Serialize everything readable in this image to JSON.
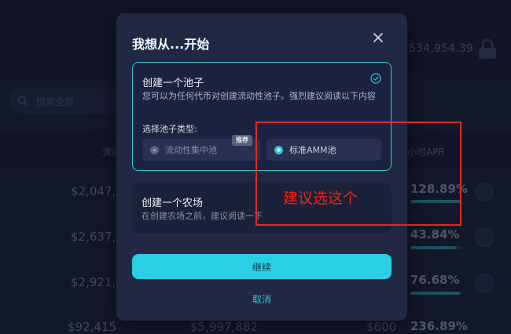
{
  "background": {
    "total_value": "534,954.39",
    "search_placeholder": "搜索全部",
    "columns": [
      "流动",
      "小时APR"
    ],
    "rows": [
      {
        "liquidity": "$2,047,0",
        "apr": "128.89%",
        "apr_fill": 0.98
      },
      {
        "liquidity": "$2,637,0",
        "apr": "43.84%",
        "apr_fill": 0.88
      },
      {
        "liquidity": "$2,921,4",
        "apr": "76.68%",
        "apr_fill": 0.95
      },
      {
        "liquidity": "$92,415",
        "volume": "$5,997,882",
        "fees": "$600",
        "apr": "236.89%",
        "apr_fill": 0.98
      }
    ]
  },
  "modal": {
    "title": "我想从...开始",
    "pool_card": {
      "title": "创建一个池子",
      "description": "您可以为任何代币对创建流动性池子。强烈建议阅读以下内容",
      "type_label": "选择池子类型:",
      "options": [
        {
          "label": "流动性集中池",
          "selected": false,
          "badge": "推荐"
        },
        {
          "label": "标准AMM池",
          "selected": true
        }
      ]
    },
    "farm_card": {
      "title": "创建一个农场",
      "description": "在创建农场之前，建议阅读一下"
    },
    "continue_label": "继续",
    "cancel_label": "取消"
  },
  "annotation": {
    "text": "建议选这个",
    "color": "#e02a1f"
  },
  "colors": {
    "accent": "#2bcfe3",
    "modal_bg": "#212844",
    "page_bg": "#1a1f36"
  }
}
